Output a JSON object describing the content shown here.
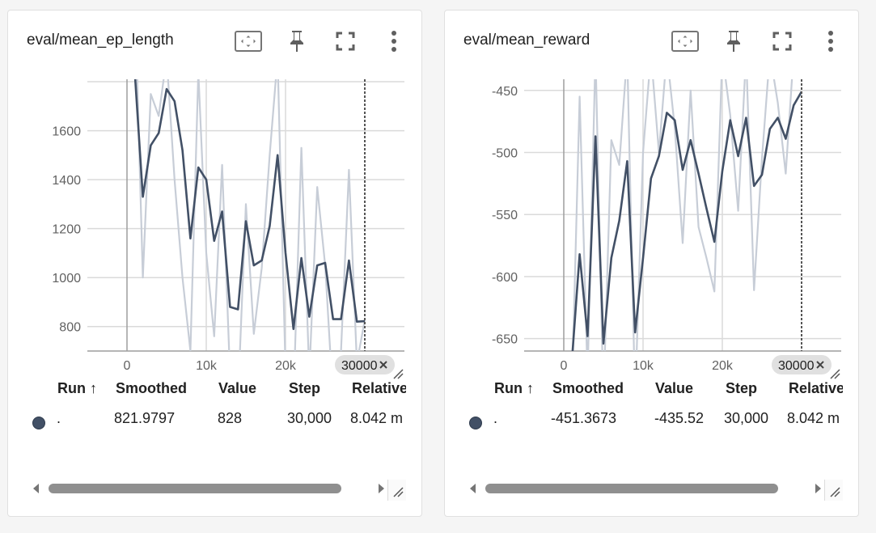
{
  "colors": {
    "smoothed_line": "#425066",
    "raw_line": "#c7cdd7",
    "grid": "#dadada",
    "axis": "#9e9e9e",
    "text_muted": "#616161",
    "chip_bg": "#e0e0e0",
    "run_dot": "#425066"
  },
  "icons": {
    "fit_domain": "fit-to-domain-icon",
    "pin": "pin-icon",
    "fullscreen": "fullscreen-icon",
    "more": "more-vert-icon",
    "close": "close-icon",
    "sort": "arrow-up-icon",
    "scroll_left": "chevron-left-icon",
    "scroll_right": "chevron-right-icon",
    "resize": "resize-handle-icon"
  },
  "cards": [
    {
      "title": "eval/mean_ep_length",
      "columns": {
        "run": "Run",
        "sort_arrow": "↑",
        "smoothed": "Smoothed",
        "value": "Value",
        "step": "Step",
        "relative": "Relative"
      },
      "row": {
        "run": ".",
        "smoothed": "821.9797",
        "value": "828",
        "step": "30,000",
        "relative": "8.042 m"
      },
      "cursor_chip": "30000",
      "chart_data": {
        "type": "line",
        "title": "eval/mean_ep_length",
        "x_ticks": [
          0,
          10000,
          20000
        ],
        "x_tick_labels": [
          "0",
          "10k",
          "20k"
        ],
        "y_ticks": [
          800,
          1000,
          1200,
          1400,
          1600,
          1800
        ],
        "y_tick_labels": [
          "800",
          "1000",
          "1200",
          "1400",
          "1600",
          "1800"
        ],
        "xlim": [
          -5000,
          35000
        ],
        "ylim": [
          700,
          1810
        ],
        "cursor_step": 30000,
        "grid": true,
        "series": [
          {
            "role": "raw",
            "x": [
              1000,
              2000,
              3000,
              4000,
              5000,
              6000,
              7000,
              8000,
              9000,
              10000,
              11000,
              12000,
              13000,
              14000,
              15000,
              16000,
              17000,
              18000,
              19000,
              20000,
              21000,
              22000,
              23000,
              24000,
              25000,
              26000,
              27000,
              28000,
              29000,
              30000
            ],
            "values": [
              2150,
              1000,
              1750,
              1660,
              1900,
              1400,
              1000,
              700,
              1840,
              1100,
              760,
              1460,
              600,
              500,
              1300,
              770,
              1040,
              1500,
              1900,
              620,
              500,
              1530,
              600,
              1370,
              1050,
              500,
              700,
              1440,
              650,
              828
            ]
          },
          {
            "role": "smoothed",
            "x": [
              1000,
              2000,
              3000,
              4000,
              5000,
              6000,
              7000,
              8000,
              9000,
              10000,
              11000,
              12000,
              13000,
              14000,
              15000,
              16000,
              17000,
              18000,
              19000,
              20000,
              21000,
              22000,
              23000,
              24000,
              25000,
              26000,
              27000,
              28000,
              29000,
              30000
            ],
            "values": [
              1830,
              1330,
              1540,
              1590,
              1770,
              1720,
              1520,
              1160,
              1450,
              1400,
              1150,
              1270,
              880,
              870,
              1230,
              1050,
              1070,
              1210,
              1500,
              1100,
              790,
              1080,
              840,
              1050,
              1060,
              830,
              830,
              1070,
              820,
              822
            ]
          }
        ]
      }
    },
    {
      "title": "eval/mean_reward",
      "columns": {
        "run": "Run",
        "sort_arrow": "↑",
        "smoothed": "Smoothed",
        "value": "Value",
        "step": "Step",
        "relative": "Relative"
      },
      "row": {
        "run": ".",
        "smoothed": "-451.3673",
        "value": "-435.52",
        "step": "30,000",
        "relative": "8.042 m"
      },
      "cursor_chip": "30000",
      "chart_data": {
        "type": "line",
        "title": "eval/mean_reward",
        "x_ticks": [
          0,
          10000,
          20000
        ],
        "x_tick_labels": [
          "0",
          "10k",
          "20k"
        ],
        "y_ticks": [
          -650,
          -600,
          -550,
          -500,
          -450
        ],
        "y_tick_labels": [
          "-650",
          "-600",
          "-550",
          "-500",
          "-450"
        ],
        "xlim": [
          -5000,
          35000
        ],
        "ylim": [
          -660,
          -441
        ],
        "cursor_step": 30000,
        "grid": true,
        "series": [
          {
            "role": "raw",
            "x": [
              1000,
              2000,
              3000,
              4000,
              5000,
              6000,
              7000,
              8000,
              9000,
              10000,
              11000,
              12000,
              13000,
              14000,
              15000,
              16000,
              17000,
              18000,
              19000,
              20000,
              21000,
              22000,
              23000,
              24000,
              25000,
              26000,
              27000,
              28000,
              29000,
              30000
            ],
            "values": [
              -700,
              -455,
              -680,
              -420,
              -700,
              -490,
              -510,
              -420,
              -700,
              -500,
              -420,
              -500,
              -420,
              -480,
              -573,
              -450,
              -560,
              -585,
              -612,
              -420,
              -470,
              -547,
              -420,
              -611,
              -505,
              -420,
              -460,
              -517,
              -420,
              -435.52
            ],
            "note_hidden": null
          },
          {
            "role": "smoothed",
            "x": [
              1000,
              2000,
              3000,
              4000,
              5000,
              6000,
              7000,
              8000,
              9000,
              10000,
              11000,
              12000,
              13000,
              14000,
              15000,
              16000,
              17000,
              18000,
              19000,
              20000,
              21000,
              22000,
              23000,
              24000,
              25000,
              26000,
              27000,
              28000,
              29000,
              30000
            ],
            "values": [
              -670,
              -582,
              -648,
              -487,
              -654,
              -585,
              -555,
              -507,
              -645,
              -585,
              -521,
              -503,
              -468,
              -474,
              -514,
              -490,
              -517,
              -545,
              -572,
              -515,
              -474,
              -503,
              -472,
              -527,
              -518,
              -481,
              -472,
              -489,
              -462,
              -451
            ]
          }
        ]
      }
    }
  ]
}
